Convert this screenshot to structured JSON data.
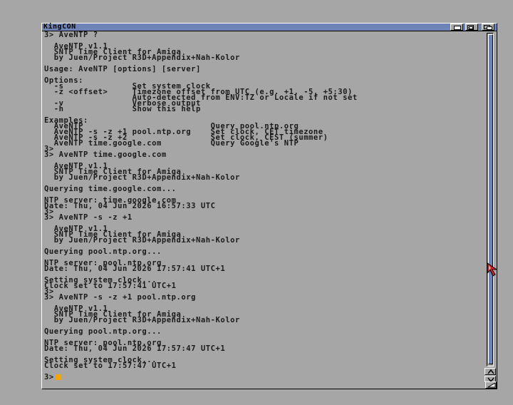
{
  "window": {
    "title": "KingCON"
  },
  "gadgets": {
    "iconify_icon": "iconify-gadget-icon",
    "zoom_icon": "zoom-gadget-icon",
    "depth_icon": "depth-gadget-icon"
  },
  "console": {
    "lines": [
      "3> AveNTP ?",
      "",
      "  AveNTP v1.1",
      "  SNTP Time Client for Amiga",
      "  by Juen/Project R3D+Appendix+Nah-Kolor",
      "",
      "Usage: AveNTP [options] [server]",
      "",
      "Options:",
      "  -s              Set system clock",
      "  -z <offset>     Timezone offset from UTC (e.g. +1, -5, +5:30)",
      "                  Auto-detected from ENV:TZ or Locale if not set",
      "  -v              Verbose output",
      "  -h              Show this help",
      "",
      "Examples:",
      "  AveNTP                          Query pool.ntp.org",
      "  AveNTP -s -z +1 pool.ntp.org    Set clock, CET timezone",
      "  AveNTP -s -z +2                 Set clock, CEST (summer)",
      "  AveNTP time.google.com          Query Google's NTP",
      "3>",
      "3> AveNTP time.google.com",
      "",
      "  AveNTP v1.1",
      "  SNTP Time Client for Amiga",
      "  by Juen/Project R3D+Appendix+Nah-Kolor",
      "",
      "Querying time.google.com...",
      "",
      "NTP server: time.google.com",
      "Date: Thu, 04 Jun 2026 16:57:33 UTC",
      "3>",
      "3> AveNTP -s -z +1",
      "",
      "  AveNTP v1.1",
      "  SNTP Time Client for Amiga",
      "  by Juen/Project R3D+Appendix+Nah-Kolor",
      "",
      "Querying pool.ntp.org...",
      "",
      "NTP server: pool.ntp.org",
      "Date: Thu, 04 Jun 2026 17:57:41 UTC+1",
      "",
      "Setting system clock...",
      "Clock set to 17:57:41 UTC+1",
      "3>",
      "3> AveNTP -s -z +1 pool.ntp.org",
      "",
      "  AveNTP v1.1",
      "  SNTP Time Client for Amiga",
      "  by Juen/Project R3D+Appendix+Nah-Kolor",
      "",
      "Querying pool.ntp.org...",
      "",
      "NTP server: pool.ntp.org",
      "Date: Thu, 04 Jun 2026 17:57:47 UTC+1",
      "",
      "Setting system clock...",
      "Clock set to 17:57:47 UTC+1"
    ],
    "prompt": "3>",
    "cursor_color": "#f5a400"
  },
  "colors": {
    "background": "#a6a6a6",
    "titlebar": "#6f84b6",
    "text": "#1a1a1a",
    "accent_pointer": "#c8202a"
  },
  "scrollbar": {
    "up_icon": "scroll-up-arrow-icon",
    "down_icon": "scroll-down-arrow-icon",
    "resize_icon": "resize-gadget-icon"
  },
  "pointer": {
    "icon": "mouse-pointer-icon"
  }
}
